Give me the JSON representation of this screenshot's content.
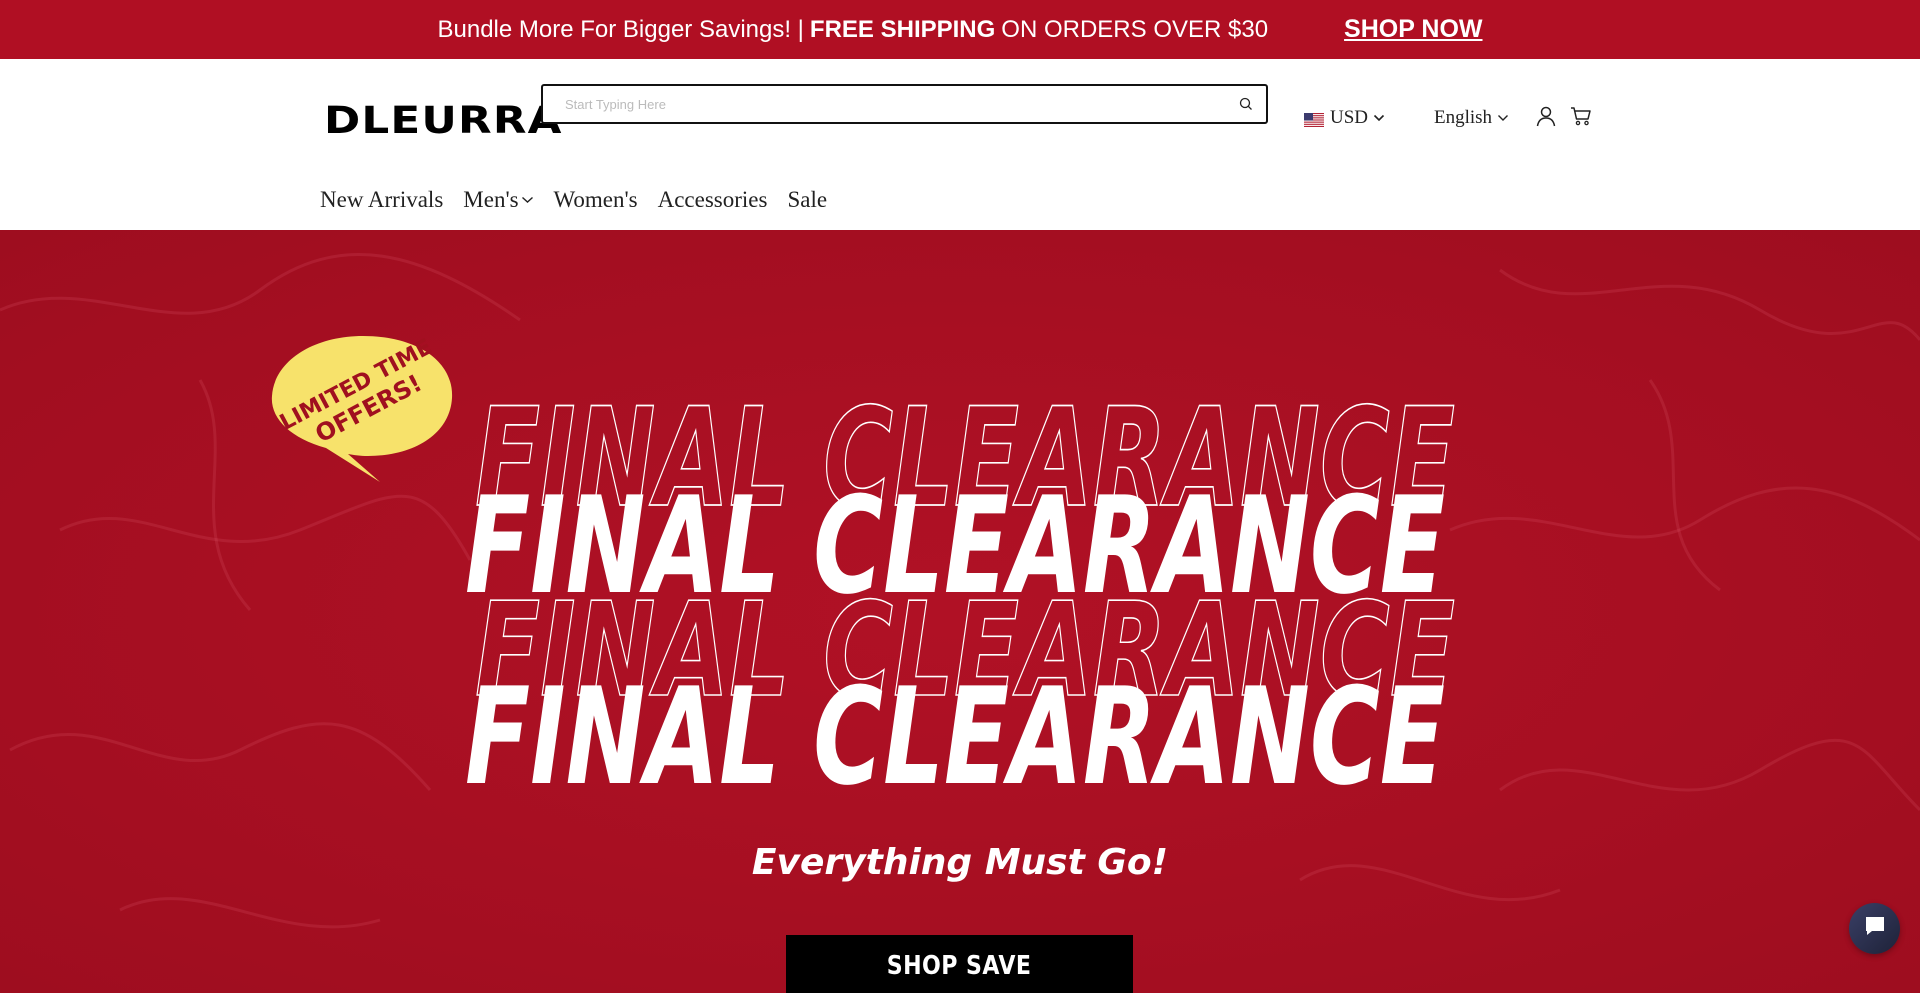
{
  "announcement": {
    "text_before": "Bundle More For Bigger Savings! |",
    "text_bold": "FREE SHIPPING",
    "text_after": "ON ORDERS OVER $30",
    "link_label": "SHOP NOW"
  },
  "header": {
    "logo": "DLEURRA",
    "search": {
      "placeholder": "Start Typing Here",
      "value": ""
    },
    "currency": {
      "selected": "USD",
      "flag": "us-flag-icon"
    },
    "language": {
      "selected": "English"
    }
  },
  "nav": {
    "items": [
      {
        "label": "New Arrivals",
        "has_dropdown": false
      },
      {
        "label": "Men's",
        "has_dropdown": true
      },
      {
        "label": "Women's",
        "has_dropdown": false
      },
      {
        "label": "Accessories",
        "has_dropdown": false
      },
      {
        "label": "Sale",
        "has_dropdown": false
      }
    ]
  },
  "hero": {
    "badge": {
      "line1": "LIMITED TIME",
      "line2": "OFFERS!"
    },
    "headline": "FINAL CLEARANCE",
    "tagline": "Everything Must Go!",
    "cta_label": "SHOP SAVE"
  },
  "colors": {
    "brand_red": "#b00f23",
    "hero_red": "#ad0f22",
    "badge_yellow": "#f7e26b",
    "cta_black": "#000000"
  }
}
